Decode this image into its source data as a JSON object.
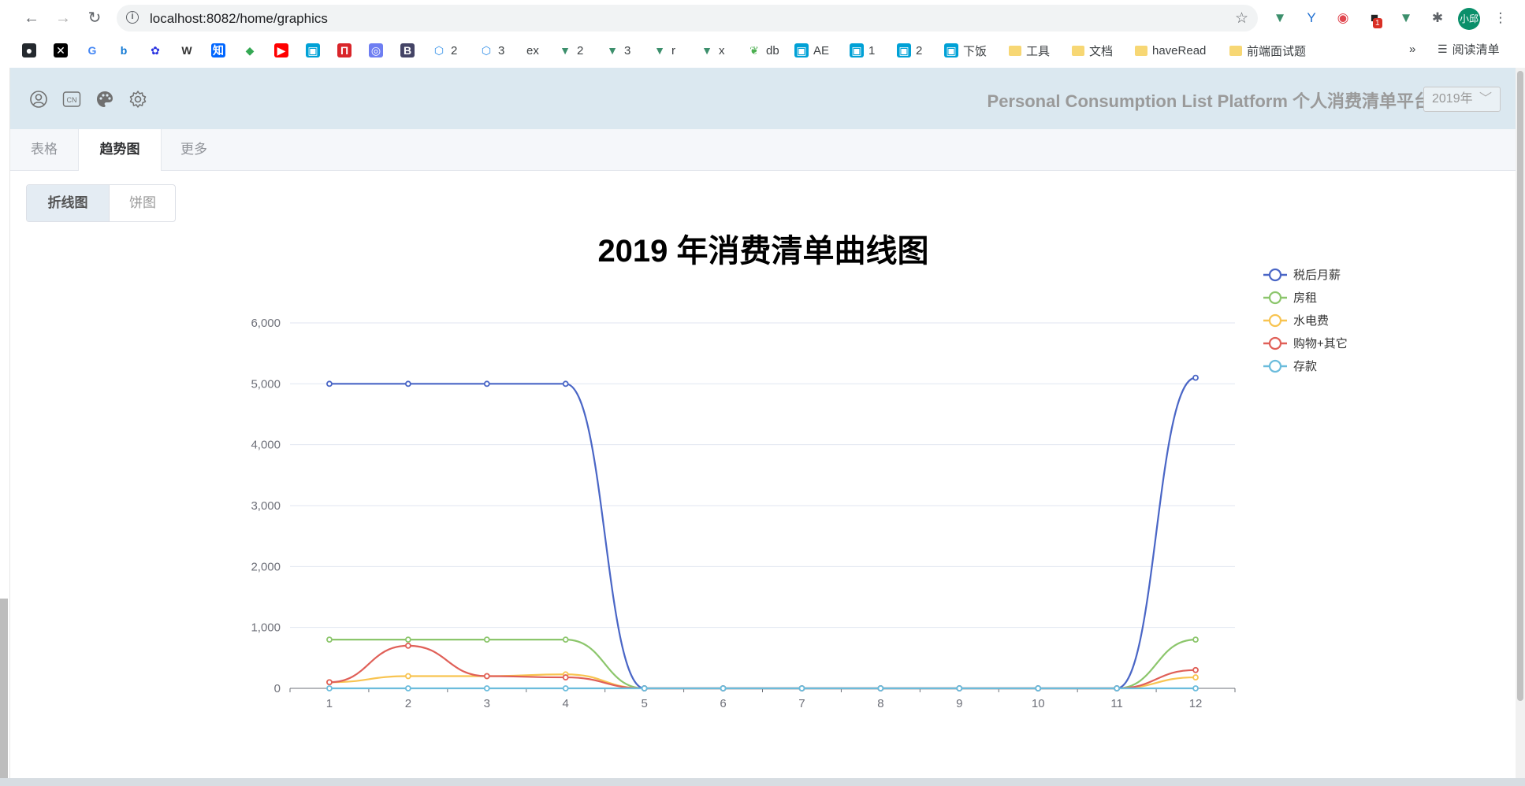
{
  "browser": {
    "url": "localhost:8082/home/graphics",
    "avatar_text": "小邱",
    "badge_count": "1",
    "reading_list": "阅读清单",
    "overflow": "»",
    "bookmarks": [
      {
        "label": "",
        "icon": "github-icon",
        "color": "#24292e"
      },
      {
        "label": "",
        "icon": "x-circle-icon",
        "color": "#000000"
      },
      {
        "label": "",
        "icon": "google-icon",
        "color": "#4285f4"
      },
      {
        "label": "",
        "icon": "bing-icon",
        "color": "#0f78d4"
      },
      {
        "label": "",
        "icon": "baidu-icon",
        "color": "#2932e1"
      },
      {
        "label": "",
        "icon": "wikipedia-icon",
        "color": "#333333"
      },
      {
        "label": "",
        "icon": "zhihu-icon",
        "color": "#0066ff"
      },
      {
        "label": "",
        "icon": "maps-icon",
        "color": "#34a853"
      },
      {
        "label": "",
        "icon": "youtube-icon",
        "color": "#ff0000"
      },
      {
        "label": "",
        "icon": "bilibili-icon",
        "color": "#00a1d6"
      },
      {
        "label": "",
        "icon": "n-icon",
        "color": "#d9252a"
      },
      {
        "label": "",
        "icon": "chrome-icon",
        "color": "#6e7ef2"
      },
      {
        "label": "",
        "icon": "b-icon",
        "color": "#444466"
      },
      {
        "label": "2",
        "icon": "hexagon-icon",
        "color": "#2f8ee8"
      },
      {
        "label": "3",
        "icon": "hexagon-icon",
        "color": "#2f8ee8"
      },
      {
        "label": "ex",
        "icon": "",
        "color": "#333333"
      },
      {
        "label": "2",
        "icon": "vue-icon",
        "color": "#3c8f6c"
      },
      {
        "label": "3",
        "icon": "vue-icon",
        "color": "#3c8f6c"
      },
      {
        "label": "r",
        "icon": "vue-icon",
        "color": "#3c8f6c"
      },
      {
        "label": "x",
        "icon": "vue-icon",
        "color": "#3c8f6c"
      },
      {
        "label": "db",
        "icon": "leaf-icon",
        "color": "#4caf50"
      },
      {
        "label": "AE",
        "icon": "bilibili-icon",
        "color": "#00a1d6"
      },
      {
        "label": "1",
        "icon": "bilibili-icon",
        "color": "#00a1d6"
      },
      {
        "label": "2",
        "icon": "bilibili-icon",
        "color": "#00a1d6"
      },
      {
        "label": "下饭",
        "icon": "bilibili-icon",
        "color": "#00a1d6"
      },
      {
        "label": "工具",
        "icon": "folder-icon",
        "color": "#f7d774"
      },
      {
        "label": "文档",
        "icon": "folder-icon",
        "color": "#f7d774"
      },
      {
        "label": "haveRead",
        "icon": "folder-icon",
        "color": "#f7d774"
      },
      {
        "label": "前端面试题",
        "icon": "folder-icon",
        "color": "#f7d774"
      }
    ]
  },
  "header": {
    "title": "Personal Consumption List Platform 个人消费清单平台",
    "year_select": "2019年"
  },
  "tabs": [
    {
      "label": "表格",
      "active": false
    },
    {
      "label": "趋势图",
      "active": true
    },
    {
      "label": "更多",
      "active": false
    }
  ],
  "chart_toggle": {
    "line_label": "折线图",
    "pie_label": "饼图"
  },
  "chart_data": {
    "type": "line",
    "title": "2019 年消费清单曲线图",
    "smooth": true,
    "grid": true,
    "legend_position": "top-right",
    "categories": [
      "1",
      "2",
      "3",
      "4",
      "5",
      "6",
      "7",
      "8",
      "9",
      "10",
      "11",
      "12"
    ],
    "ylim": [
      0,
      6000
    ],
    "yticks": [
      0,
      1000,
      2000,
      3000,
      4000,
      5000,
      6000
    ],
    "ytick_labels": [
      "0",
      "1,000",
      "2,000",
      "3,000",
      "4,000",
      "5,000",
      "6,000"
    ],
    "series": [
      {
        "name": "税后月薪",
        "color": "#4a66c6",
        "values": [
          5000,
          5000,
          5000,
          5000,
          0,
          0,
          0,
          0,
          0,
          0,
          0,
          5100
        ]
      },
      {
        "name": "房租",
        "color": "#8cc66c",
        "values": [
          800,
          800,
          800,
          800,
          0,
          0,
          0,
          0,
          0,
          0,
          0,
          800
        ]
      },
      {
        "name": "水电费",
        "color": "#f8c451",
        "values": [
          100,
          200,
          200,
          230,
          0,
          0,
          0,
          0,
          0,
          0,
          0,
          180
        ]
      },
      {
        "name": "购物+其它",
        "color": "#e06058",
        "values": [
          100,
          700,
          200,
          180,
          0,
          0,
          0,
          0,
          0,
          0,
          0,
          300
        ]
      },
      {
        "name": "存款",
        "color": "#6bbcdc",
        "values": [
          0,
          0,
          0,
          0,
          0,
          0,
          0,
          0,
          0,
          0,
          0,
          0
        ]
      }
    ]
  }
}
